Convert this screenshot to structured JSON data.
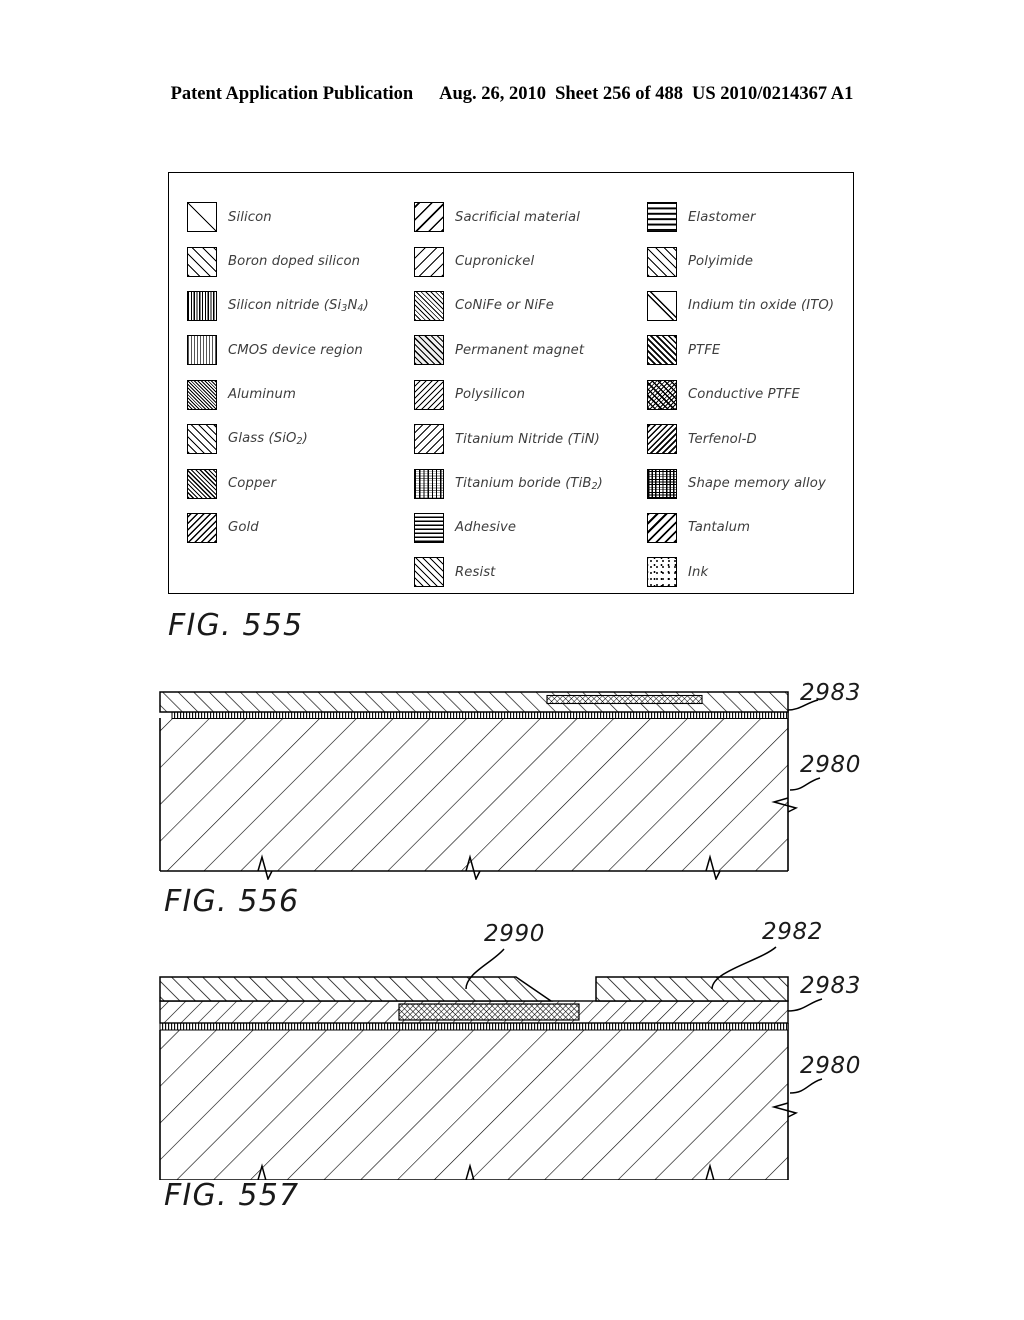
{
  "header": {
    "publication": "Patent Application Publication",
    "date": "Aug. 26, 2010",
    "sheet": "Sheet 256 of 488",
    "patent_number": "US 2010/0214367 A1"
  },
  "legend": {
    "figure_label": "FIG. 555",
    "columns": [
      {
        "items": [
          {
            "label": "Silicon",
            "pattern": "sw-silicon"
          },
          {
            "label": "Boron doped silicon",
            "pattern": "sw-boron"
          },
          {
            "label": "Silicon nitride (Si",
            "sub": "3",
            "label2": "N",
            "sub2": "4",
            "label3": ")",
            "pattern": "sw-sinitride"
          },
          {
            "label": "CMOS device region",
            "pattern": "sw-cmos"
          },
          {
            "label": "Aluminum",
            "pattern": "sw-aluminum"
          },
          {
            "label": "Glass (SiO",
            "sub": "2",
            "label2": ")",
            "pattern": "sw-glass"
          },
          {
            "label": "Copper",
            "pattern": "sw-copper"
          },
          {
            "label": "Gold",
            "pattern": "sw-gold"
          }
        ]
      },
      {
        "items": [
          {
            "label": "Sacrificial material",
            "pattern": "sw-sacrificial"
          },
          {
            "label": "Cupronickel",
            "pattern": "sw-cupronickel"
          },
          {
            "label": "CoNiFe or NiFe",
            "pattern": "sw-conife"
          },
          {
            "label": "Permanent magnet",
            "pattern": "sw-magnet"
          },
          {
            "label": "Polysilicon",
            "pattern": "sw-polysilicon"
          },
          {
            "label": "Titanium Nitride (TiN)",
            "pattern": "sw-tin"
          },
          {
            "label": "Titanium boride (TiB",
            "sub": "2",
            "label2": ")",
            "pattern": "sw-tib2"
          },
          {
            "label": "Adhesive",
            "pattern": "sw-adhesive"
          },
          {
            "label": "Resist",
            "pattern": "sw-resist"
          }
        ]
      },
      {
        "items": [
          {
            "label": "Elastomer",
            "pattern": "sw-elastomer"
          },
          {
            "label": "Polyimide",
            "pattern": "sw-polyimide"
          },
          {
            "label": "Indium tin oxide (ITO)",
            "pattern": "sw-ito"
          },
          {
            "label": "PTFE",
            "pattern": "sw-ptfe"
          },
          {
            "label": "Conductive PTFE",
            "pattern": "sw-cond-ptfe"
          },
          {
            "label": "Terfenol-D",
            "pattern": "sw-terfenol"
          },
          {
            "label": "Shape memory alloy",
            "pattern": "sw-sma"
          },
          {
            "label": "Tantalum",
            "pattern": "sw-tantalum"
          },
          {
            "label": "Ink",
            "pattern": "sw-ink"
          }
        ]
      }
    ]
  },
  "figures": [
    {
      "label": "FIG. 556",
      "reference_numerals": [
        "2983",
        "2980"
      ],
      "description": "Cross-section: substrate with upper hatched layer and thin dotted interlayer, three break marks along bottom edge"
    },
    {
      "label": "FIG. 557",
      "reference_numerals": [
        "2990",
        "2982",
        "2983",
        "2980"
      ],
      "description": "Cross-section: substrate with patterned upper layers forming a trench/gap with embedded block"
    }
  ]
}
